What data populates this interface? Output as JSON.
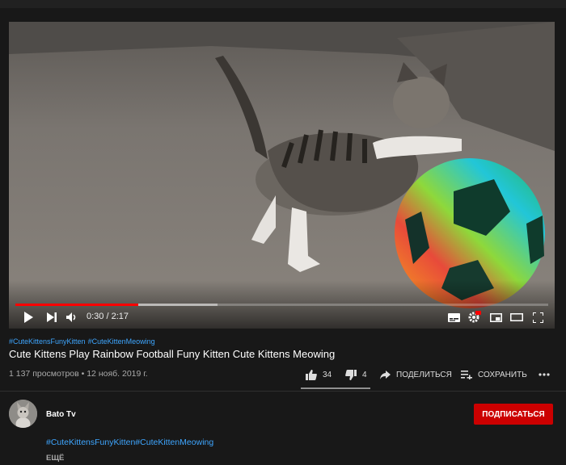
{
  "player": {
    "time_current": "0:30",
    "time_separator": " / ",
    "time_total": "2:17",
    "progress_played_fraction": 0.23,
    "progress_buffered_fraction": 0.38
  },
  "video": {
    "hashtags": [
      "#CuteKittensFunyKitten",
      "#CuteKittenMeowing"
    ],
    "title": "Cute Kittens Play Rainbow Football Funy Kitten Cute Kittens Meowing",
    "views": "1 137 просмотров",
    "meta_separator": " • ",
    "date": "12 нояб. 2019 г."
  },
  "actions": {
    "likes": "34",
    "dislikes": "4",
    "share_label": "ПОДЕЛИТЬСЯ",
    "save_label": "СОХРАНИТЬ"
  },
  "channel": {
    "name": "Bato Tv",
    "subscribe_label": "ПОДПИСАТЬСЯ"
  },
  "description": {
    "hashtags_line": "#CuteKittensFunyKitten#CuteKittenMeowing",
    "more_label": "ЕЩЁ"
  },
  "colors": {
    "background": "#181818",
    "link": "#3ea6ff",
    "subscribe": "#cc0000",
    "progress": "#ff0000"
  },
  "icons": [
    "play-icon",
    "next-icon",
    "volume-icon",
    "subtitles-icon",
    "settings-icon",
    "miniplayer-icon",
    "theater-icon",
    "fullscreen-icon",
    "thumbs-up-icon",
    "thumbs-down-icon",
    "share-icon",
    "save-playlist-icon",
    "more-icon"
  ]
}
